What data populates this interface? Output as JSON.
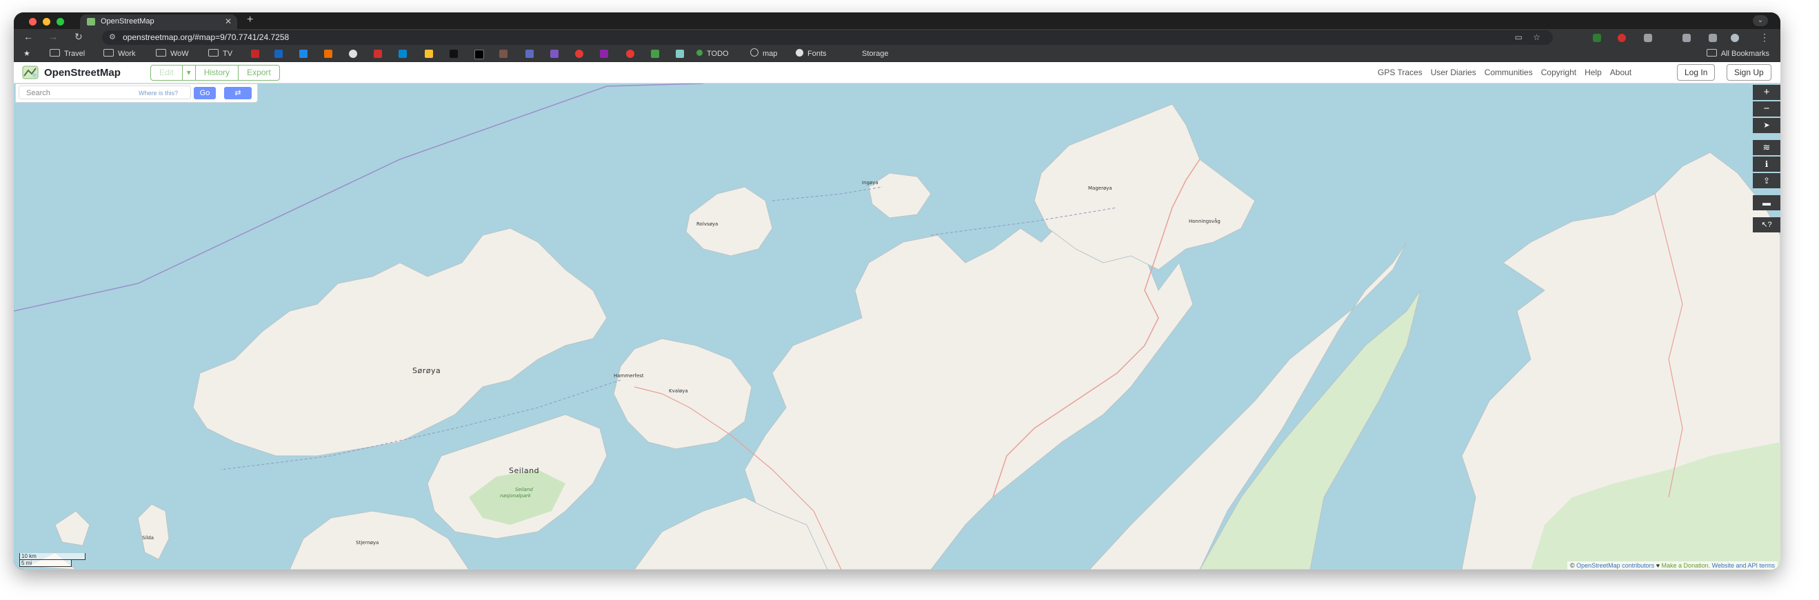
{
  "browser": {
    "tab_title": "OpenStreetMap",
    "tab_close": "✕",
    "new_tab": "+",
    "tab_menu": "⌄",
    "url": "openstreetmap.org/#map=9/70.7741/24.7258",
    "nav": {
      "back": "←",
      "forward": "→",
      "reload": "↻",
      "site_info": "⚙"
    },
    "star": "☆",
    "menu": "⋮",
    "bookmarks": {
      "star": "★",
      "folders": [
        "Travel",
        "Work",
        "WoW",
        "TV"
      ],
      "todo": "TODO",
      "map": "map",
      "fonts": "Fonts",
      "storage": "Storage",
      "all": "All Bookmarks"
    }
  },
  "osm": {
    "site_name": "OpenStreetMap",
    "edit_tabs": {
      "edit": "Edit",
      "caret": "▾",
      "history": "History",
      "export": "Export"
    },
    "nav_links": [
      "GPS Traces",
      "User Diaries",
      "Communities",
      "Copyright",
      "Help",
      "About"
    ],
    "auth": {
      "login": "Log In",
      "signup": "Sign Up"
    },
    "search": {
      "placeholder": "Search",
      "where": "Where is this?",
      "go": "Go",
      "directions": "⇄"
    },
    "controls": {
      "zoom_in": "+",
      "zoom_out": "−",
      "locate": "➤",
      "layers": "≋",
      "info": "ℹ",
      "share": "⇪",
      "note": "▬",
      "query": "↖?"
    },
    "map_labels": {
      "soroya": "Sørøya",
      "seiland": "Seiland",
      "seiland_park": "Seiland",
      "seiland_park2": "nasjonalpark",
      "kvaloya": "Kvaløya",
      "hammerfest": "Hammerfest",
      "ingoya": "Ingøya",
      "rolvsoya": "Rolvsøya",
      "mageroya": "Magerøya",
      "honningsvag": "Honningsvåg",
      "stjernoya": "Stjernøya",
      "silda": "Silda"
    },
    "scale": {
      "km": "10 km",
      "mi": "5 mi"
    },
    "attribution": {
      "copyright": "©",
      "contributors": "OpenStreetMap contributors",
      "heart": "♥",
      "donation": "Make a Donation.",
      "terms": "Website and API terms"
    }
  },
  "colors": {
    "water": "#aad3df",
    "land": "#f2efe9",
    "forest": "#add19e",
    "accent_green": "#7ebc6f",
    "go_blue": "#7092ff"
  }
}
